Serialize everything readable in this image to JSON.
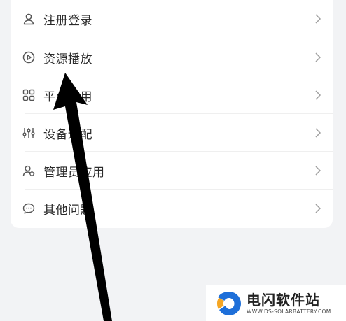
{
  "menu": {
    "items": [
      {
        "label": "注册登录",
        "icon": "user-icon"
      },
      {
        "label": "资源播放",
        "icon": "play-circle-icon"
      },
      {
        "label": "平台应用",
        "icon": "grid-icon"
      },
      {
        "label": "设备适配",
        "icon": "sliders-icon"
      },
      {
        "label": "管理员应用",
        "icon": "admin-user-icon"
      },
      {
        "label": "其他问题",
        "icon": "chat-bubble-icon"
      }
    ]
  },
  "watermark": {
    "name": "电闪软件站",
    "url": "WWW.DS-SOLARBATTERY.COM"
  },
  "colors": {
    "background": "#f2f3f5",
    "card": "#ffffff",
    "text": "#2b2b2b",
    "icon": "#555555",
    "chevron": "#a0a0a0",
    "annotation_arrow": "#000000",
    "logo_blue": "#1e6fd9",
    "logo_orange": "#f5a623"
  }
}
